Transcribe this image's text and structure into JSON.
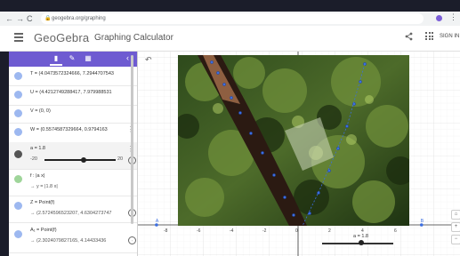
{
  "browser": {
    "url": "geogebra.org/graphing",
    "nav_back": "←",
    "nav_forward": "→",
    "nav_reload": "C",
    "lock_icon": "🔒",
    "menu": "⋮"
  },
  "header": {
    "brand": "GeoGebra",
    "subtitle": "Graphing Calculator",
    "signin": "SIGN IN"
  },
  "algebra": {
    "collapse": "‹",
    "rows": [
      {
        "text": "T = (4.0473572324666, 7.2944707543"
      },
      {
        "text": "U = (4.4212749288417, 7.979988531"
      },
      {
        "text": "V = (0, 0)"
      },
      {
        "text": "W = (0.5574587329664, 0.9794163"
      },
      {
        "label": "a = 1.8",
        "min": "-20",
        "max": "20",
        "value": 1.8
      },
      {
        "text": "f : |a x|",
        "sub": "→ y = |1.8 x|"
      },
      {
        "text": "Z = Point(f)",
        "sub": "→ (2.5724596523207, 4.6304273747"
      },
      {
        "text": "A₁ = Point(f)",
        "sub": "→ (2.3024079827165, 4.14433436"
      }
    ]
  },
  "graphics": {
    "undo": "↶",
    "x_ticks": [
      "-8",
      "-6",
      "-4",
      "-2",
      "0",
      "2",
      "4",
      "6"
    ],
    "axis_point_left": "A",
    "axis_point_right": "B",
    "slider_label": "a = 1.8",
    "slider_value": 1.8,
    "slider_min": -20,
    "slider_max": 20,
    "side_buttons": [
      "⌂",
      "+",
      "−"
    ]
  }
}
